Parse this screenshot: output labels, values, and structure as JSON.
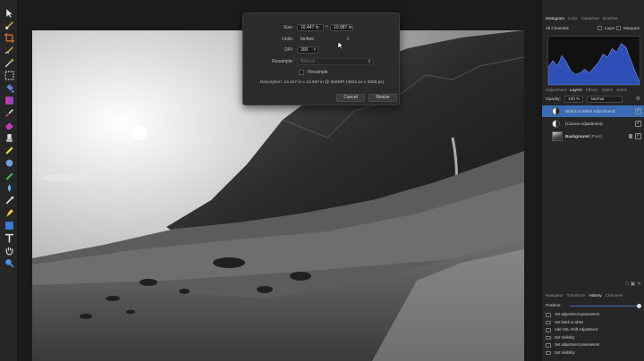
{
  "dialog": {
    "size_label": "Size:",
    "width_value": "16.447 in",
    "height_value": "10.987 in",
    "units_label": "Units:",
    "units_value": "Inches",
    "dpi_label": "DPI:",
    "dpi_value": "300",
    "resample_label": "Resample:",
    "resample_value": "Bilinear",
    "resample_check_label": "Resample",
    "description": "Description: 16.447 in x 10.987 in @ 300DPI (4934 px x 3296 px)",
    "cancel_label": "Cancel",
    "resize_label": "Resize"
  },
  "panels": {
    "top_tabs": [
      "Histogram",
      "Color",
      "Swatches",
      "Brushes"
    ],
    "channels_value": "All Channels",
    "layer_check_label": "Layer",
    "marquee_check_label": "Marquee",
    "mid_tabs": [
      "Adjustment",
      "Layers",
      "Effects",
      "Styles",
      "Stock"
    ],
    "opacity_label": "Opacity:",
    "opacity_value": "100 %",
    "blend_mode": "Normal",
    "layers": [
      {
        "name": "(Black & White Adjustment)",
        "selected": true
      },
      {
        "name": "(Curves Adjustment)",
        "selected": false
      },
      {
        "name": "Background",
        "suffix": "(Pixel)",
        "selected": false
      }
    ],
    "bottom_tabs": [
      "Navigator",
      "Transform",
      "History",
      "Channels"
    ],
    "position_label": "Position:",
    "history_items": [
      "Set adjustment parameters",
      "Set black & white",
      "Add HSL Shift Adjustment",
      "Set Visibility",
      "Set adjustment parameters",
      "Set Visibility"
    ]
  },
  "colors": {
    "selection_blue": "#3b6bb4",
    "histogram_blue": "#2f4fb7",
    "panel_bg": "#262626"
  },
  "icons": [
    "move-icon",
    "brush-icon",
    "crop-icon",
    "selection-brush-icon",
    "magic-wand-icon",
    "marquee-icon",
    "flood-fill-icon",
    "gradient-icon",
    "paint-brush-icon",
    "erase-icon",
    "clone-icon",
    "dodge-icon",
    "burn-icon",
    "sponge-icon",
    "blur-icon",
    "smudge-icon",
    "pen-icon",
    "rectangle-icon",
    "text-icon",
    "hand-icon",
    "zoom-icon"
  ]
}
